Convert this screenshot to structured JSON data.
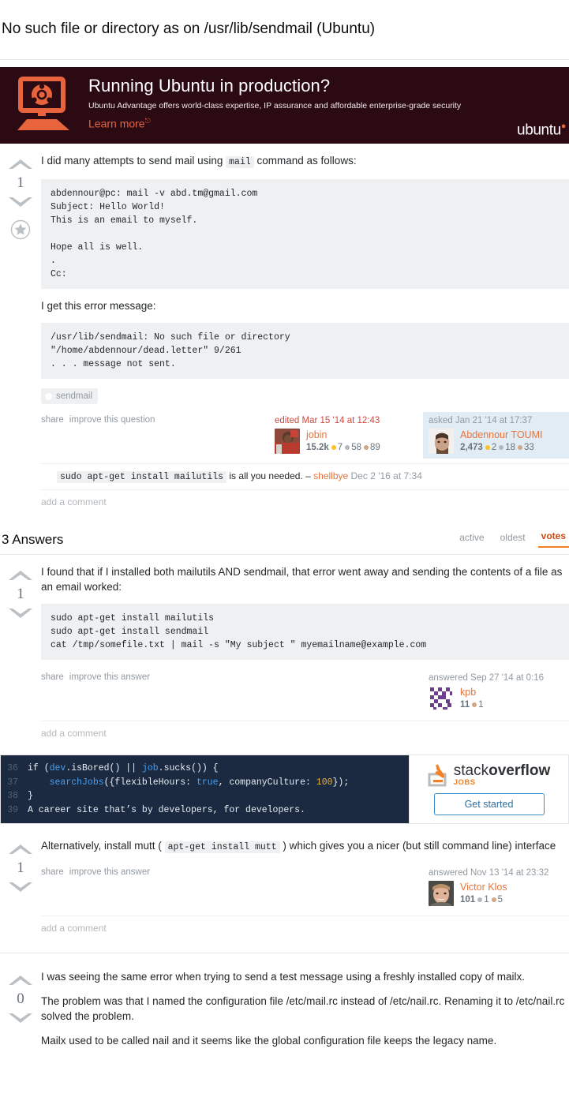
{
  "question": {
    "title": "No such file or directory as on /usr/lib/sendmail (Ubuntu)",
    "votes": "1",
    "body_intro": "I did many attempts to send mail using",
    "inline_code_mail": "mail",
    "body_intro_tail": "command as follows:",
    "code_block_1": "abdennour@pc: mail -v abd.tm@gmail.com\nSubject: Hello World!\nThis is an email to myself.\n\nHope all is well.\n.\nCc:",
    "error_lead": "I get this error message:",
    "code_block_2": "/usr/lib/sendmail: No such file or directory\n\"/home/abdennour/dead.letter\" 9/261\n. . . message not sent.",
    "tags": [
      "sendmail"
    ],
    "actions": {
      "share": "share",
      "improve": "improve this question"
    },
    "editor_card": {
      "action": "edited Mar 15 '14 at 12:43",
      "name": "jobin",
      "reputation": "15.2k",
      "gold": "7",
      "silver": "58",
      "bronze": "89"
    },
    "asker_card": {
      "action": "asked Jan 21 '14 at 17:37",
      "name": "Abdennour TOUMI",
      "reputation": "2,473",
      "gold": "2",
      "silver": "18",
      "bronze": "33"
    },
    "comments": [
      {
        "code": "sudo apt-get install mailutils",
        "text": "is all you needed. –",
        "author": "shellbye",
        "date": "Dec 2 '16 at 7:34"
      }
    ],
    "add_comment": "add a comment"
  },
  "ubuntu_ad": {
    "headline": "Running Ubuntu in production?",
    "subline": "Ubuntu Advantage offers world-class expertise, IP assurance and affordable enterprise-grade security",
    "cta": "Learn more",
    "logo": "ubuntu",
    "bg_color": "#2c0a14",
    "accent_color": "#e8643c"
  },
  "answers_section": {
    "heading": "3 Answers",
    "tabs": [
      {
        "label": "active",
        "active": false
      },
      {
        "label": "oldest",
        "active": false
      },
      {
        "label": "votes",
        "active": true
      }
    ]
  },
  "answers": [
    {
      "votes": "1",
      "paragraph": "I found that if I installed both mailutils AND sendmail, that error went away and sending the contents of a file as an email worked:",
      "code_block": "sudo apt-get install mailutils\nsudo apt-get install sendmail\ncat /tmp/somefile.txt | mail -s \"My subject \" myemailname@example.com",
      "actions": {
        "share": "share",
        "improve": "improve this answer"
      },
      "user_card": {
        "action": "answered Sep 27 '14 at 0:16",
        "name": "kpb",
        "reputation": "11",
        "bronze": "1"
      },
      "add_comment": "add a comment"
    },
    {
      "votes": "1",
      "para_pre": "Alternatively, install mutt (",
      "inline_code": "apt-get install mutt",
      "para_post": ") which gives you a nicer (but still command line) interface",
      "actions": {
        "share": "share",
        "improve": "improve this answer"
      },
      "user_card": {
        "action": "answered Nov 13 '14 at 23:32",
        "name": "Victor Klos",
        "reputation": "101",
        "silver": "1",
        "bronze": "5"
      },
      "add_comment": "add a comment"
    },
    {
      "votes": "0",
      "paragraphs": [
        "I was seeing the same error when trying to send a test message using a freshly installed copy of mailx.",
        "The problem was that I named the configuration file /etc/mail.rc instead of /etc/nail.rc. Renaming it to /etc/nail.rc solved the problem.",
        "Mailx used to be called nail and it seems like the global configuration file keeps the legacy name."
      ]
    }
  ],
  "jobs_ad": {
    "lines": [
      {
        "num": "36",
        "segments": [
          {
            "t": "if (",
            "c": "plain"
          },
          {
            "t": "dev",
            "c": "blue"
          },
          {
            "t": ".isBored() || ",
            "c": "plain"
          },
          {
            "t": "job",
            "c": "blue"
          },
          {
            "t": ".sucks()) {",
            "c": "plain"
          }
        ]
      },
      {
        "num": "37",
        "segments": [
          {
            "t": "    ",
            "c": "plain"
          },
          {
            "t": "searchJobs",
            "c": "blue"
          },
          {
            "t": "({flexibleHours: ",
            "c": "plain"
          },
          {
            "t": "true",
            "c": "blue"
          },
          {
            "t": ", companyCulture: ",
            "c": "plain"
          },
          {
            "t": "100",
            "c": "num"
          },
          {
            "t": "});",
            "c": "plain"
          }
        ]
      },
      {
        "num": "38",
        "segments": [
          {
            "t": "}",
            "c": "plain"
          }
        ]
      },
      {
        "num": "39",
        "segments": [
          {
            "t": "A career site that’s by developers, for developers.",
            "c": "plain"
          }
        ]
      }
    ],
    "logo_stack": "stack",
    "logo_overflow": "overflow",
    "logo_jobs": "JOBS",
    "cta": "Get started"
  }
}
